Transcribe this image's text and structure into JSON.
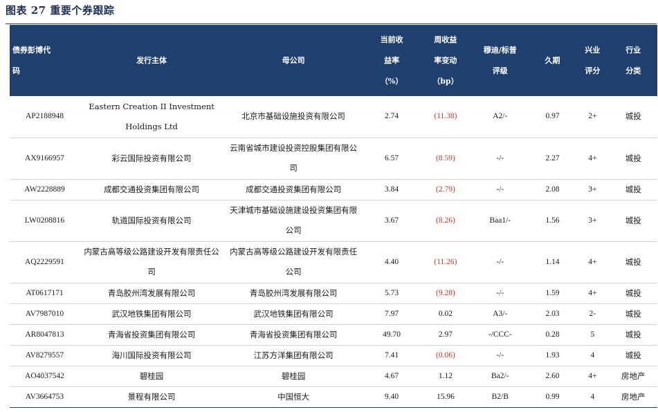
{
  "figure": {
    "title": "图表 27   重要个券跟踪"
  },
  "columns": {
    "code_l1": "债券彭博代",
    "code_l2": "码",
    "issuer": "发行主体",
    "parent": "母公司",
    "yield_l1": "当前收",
    "yield_l2": "益率",
    "yield_l3": "（%）",
    "chg_l1": "周收益",
    "chg_l2": "率变动",
    "chg_l3": "（bp）",
    "rating_l1": "穆迪/标普",
    "rating_l2": "评级",
    "duration": "久期",
    "cib_l1": "兴业",
    "cib_l2": "评分",
    "ind_l1": "行业",
    "ind_l2": "分类"
  },
  "rows": [
    {
      "code": "AP2188948",
      "issuer": "Eastern Creation II Investment Holdings Ltd",
      "parent": "北京市基础设施投资有限公司",
      "yield": "2.74",
      "change": "(11.38)",
      "change_negative": true,
      "rating": "A2/-",
      "duration": "0.97",
      "score": "2+",
      "industry": "城投"
    },
    {
      "code": "AX9166957",
      "issuer": "彩云国际投资有限公司",
      "parent": "云南省城市建设投资控股集团有限公司",
      "yield": "6.57",
      "change": "(8.59)",
      "change_negative": true,
      "rating": "-/-",
      "duration": "2.27",
      "score": "4+",
      "industry": "城投"
    },
    {
      "code": "AW2228889",
      "issuer": "成都交通投资集团有限公司",
      "parent": "成都交通投资集团有限公司",
      "yield": "3.84",
      "change": "(2.79)",
      "change_negative": true,
      "rating": "-/-",
      "duration": "2.08",
      "score": "3+",
      "industry": "城投"
    },
    {
      "code": "LW0208816",
      "issuer": "轨道国际投资有限公司",
      "parent": "天津城市基础设施建设投资集团有限公司",
      "yield": "3.67",
      "change": "(8.26)",
      "change_negative": true,
      "rating": "Baa1/-",
      "duration": "1.56",
      "score": "3+",
      "industry": "城投"
    },
    {
      "code": "AQ2229591",
      "issuer": "内蒙古高等级公路建设开发有限责任公司",
      "parent": "内蒙古高等级公路建设开发有限责任公司",
      "yield": "4.40",
      "change": "(11.26)",
      "change_negative": true,
      "rating": "-/-",
      "duration": "1.14",
      "score": "4+",
      "industry": "城投"
    },
    {
      "code": "AT0617171",
      "issuer": "青岛胶州湾发展有限公司",
      "parent": "青岛胶州湾发展有限公司",
      "yield": "5.73",
      "change": "(9.28)",
      "change_negative": true,
      "rating": "-/-",
      "duration": "1.59",
      "score": "4+",
      "industry": "城投"
    },
    {
      "code": "AV7987010",
      "issuer": "武汉地铁集团有限公司",
      "parent": "武汉地铁集团有限公司",
      "yield": "7.97",
      "change": "0.02",
      "change_negative": false,
      "rating": "A3/-",
      "duration": "2.03",
      "score": "2-",
      "industry": "城投"
    },
    {
      "code": "AR8047813",
      "issuer": "青海省投资集团有限公司",
      "parent": "青海省投资集团有限公司",
      "yield": "49.70",
      "change": "2.97",
      "change_negative": false,
      "rating": "-/CCC-",
      "duration": "0.28",
      "score": "5",
      "industry": "城投"
    },
    {
      "code": "AV8279557",
      "issuer": "海川国际投资有限公司",
      "parent": "江苏方洋集团有限公司",
      "yield": "7.41",
      "change": "(0.06)",
      "change_negative": true,
      "rating": "-/-",
      "duration": "1.93",
      "score": "4",
      "industry": "城投"
    },
    {
      "code": "AO4037542",
      "issuer": "碧桂园",
      "parent": "碧桂园",
      "yield": "4.67",
      "change": "1.12",
      "change_negative": false,
      "rating": "Ba2/-",
      "duration": "2.60",
      "score": "4+",
      "industry": "房地产"
    },
    {
      "code": "AV3664753",
      "issuer": "景程有限公司",
      "parent": "中国恒大",
      "yield": "9.40",
      "change": "15.96",
      "change_negative": false,
      "rating": "B2/B",
      "duration": "0.99",
      "score": "4",
      "industry": "房地产"
    }
  ]
}
